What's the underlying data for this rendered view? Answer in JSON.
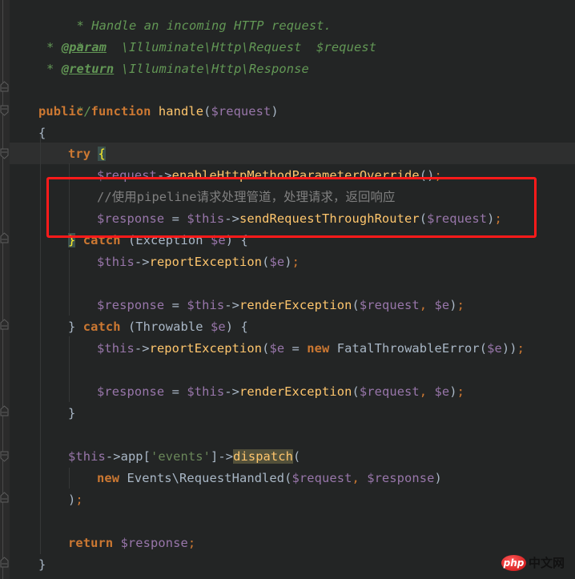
{
  "editor": {
    "language": "php",
    "theme_colors": {
      "background": "#232525",
      "keyword": "#cc7832",
      "function": "#ffc66d",
      "variable": "#9876aa",
      "doc_comment": "#629755",
      "line_comment": "#808080",
      "string": "#6a8759",
      "annotation_box": "#ff1a1a"
    },
    "lines": {
      "l0": {
        "c0": "* Handle an incoming HTTP request."
      },
      "l1": {
        "c0": "*"
      },
      "l2": {
        "c0": "* ",
        "tag": "@param",
        "c1": "  \\Illuminate\\Http\\Request  $request"
      },
      "l3": {
        "c0": "* ",
        "tag": "@return",
        "c1": " \\Illuminate\\Http\\Response"
      },
      "l4": {
        "c0": "*/"
      },
      "l5": {
        "k0": "public",
        "k1": "function",
        "fn": "handle",
        "p0": "(",
        "v0": "$request",
        "p1": ")"
      },
      "l6": {
        "p0": "{"
      },
      "l7": {
        "k0": "try",
        "brace": "{"
      },
      "l8": {
        "v0": "$request",
        "op": "->",
        "fn": "enableHttpMethodParameterOverride",
        "p0": "()",
        "semi": ";"
      },
      "l9": {
        "cmt": "//使用pipeline请求处理管道，处理请求，返回响应"
      },
      "l10": {
        "v0": "$response",
        "op0": " = ",
        "v1": "$this",
        "op1": "->",
        "fn": "sendRequestThroughRouter",
        "p0": "(",
        "v2": "$request",
        "p1": ")",
        "semi": ";"
      },
      "l11": {
        "brace": "}",
        "k0": "catch",
        "p0": " (Exception ",
        "v0": "$e",
        "p1": ") {"
      },
      "l12": {
        "v0": "$this",
        "op": "->",
        "fn": "reportException",
        "p0": "(",
        "v1": "$e",
        "p1": ")",
        "semi": ";"
      },
      "l14": {
        "v0": "$response",
        "op0": " = ",
        "v1": "$this",
        "op1": "->",
        "fn": "renderException",
        "p0": "(",
        "v2": "$request",
        "comma": ", ",
        "v3": "$e",
        "p1": ")",
        "semi": ";"
      },
      "l15": {
        "p0": "} ",
        "k0": "catch",
        "p1": " (Throwable ",
        "v0": "$e",
        "p2": ") {"
      },
      "l16": {
        "v0": "$this",
        "op": "->",
        "fn": "reportException",
        "p0": "(",
        "v1": "$e",
        "op2": " = ",
        "k0": "new",
        "cls": " FatalThrowableError(",
        "v2": "$e",
        "p1": "))",
        "semi": ";"
      },
      "l18": {
        "v0": "$response",
        "op0": " = ",
        "v1": "$this",
        "op1": "->",
        "fn": "renderException",
        "p0": "(",
        "v2": "$request",
        "comma": ", ",
        "v3": "$e",
        "p1": ")",
        "semi": ";"
      },
      "l19": {
        "p0": "}"
      },
      "l21": {
        "v0": "$this",
        "op0": "->app[",
        "str": "'events'",
        "op1": "]->",
        "fn": "dispatch",
        "p0": "("
      },
      "l22": {
        "k0": "new",
        "cls": " Events\\RequestHandled(",
        "v0": "$request",
        "comma": ", ",
        "v1": "$response",
        "p0": ")"
      },
      "l23": {
        "p0": ")",
        "semi": ";"
      },
      "l25": {
        "k0": "return",
        "v0": " $response",
        "semi": ";"
      },
      "l26": {
        "p0": "}"
      }
    }
  },
  "watermark": {
    "logo_text": "php",
    "site_text": "中文网"
  }
}
